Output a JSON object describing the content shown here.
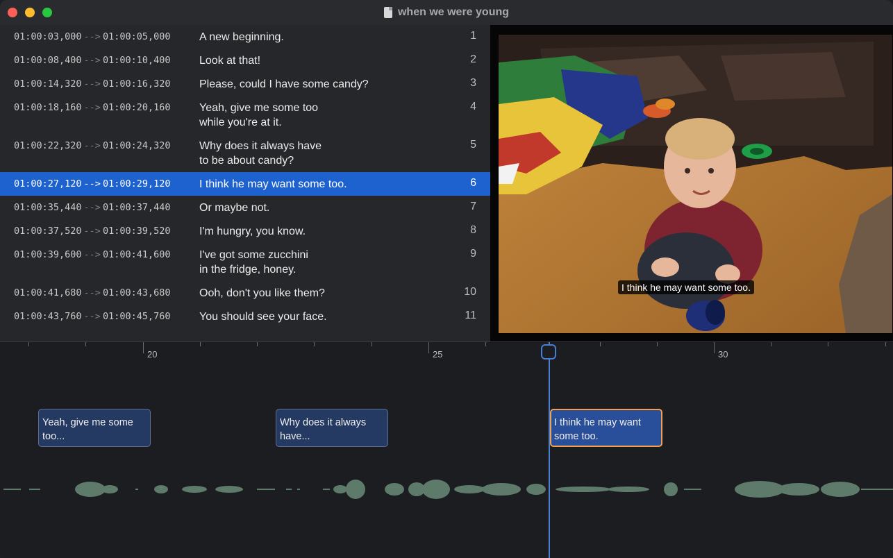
{
  "window": {
    "title": "when we were young"
  },
  "subtitles": [
    {
      "start": "01:00:03,000",
      "end": "01:00:05,000",
      "text": "A new beginning.",
      "num": "1"
    },
    {
      "start": "01:00:08,400",
      "end": "01:00:10,400",
      "text": "Look at that!",
      "num": "2"
    },
    {
      "start": "01:00:14,320",
      "end": "01:00:16,320",
      "text": "Please, could I have some candy?",
      "num": "3"
    },
    {
      "start": "01:00:18,160",
      "end": "01:00:20,160",
      "text": "Yeah, give me some too\nwhile you're at it.",
      "num": "4"
    },
    {
      "start": "01:00:22,320",
      "end": "01:00:24,320",
      "text": "Why does it always have\nto be about candy?",
      "num": "5"
    },
    {
      "start": "01:00:27,120",
      "end": "01:00:29,120",
      "text": "I think he may want some too.",
      "num": "6",
      "selected": true
    },
    {
      "start": "01:00:35,440",
      "end": "01:00:37,440",
      "text": "Or maybe not.",
      "num": "7"
    },
    {
      "start": "01:00:37,520",
      "end": "01:00:39,520",
      "text": "I'm hungry, you know.",
      "num": "8"
    },
    {
      "start": "01:00:39,600",
      "end": "01:00:41,600",
      "text": "I've got some zucchini\nin the fridge, honey.",
      "num": "9"
    },
    {
      "start": "01:00:41,680",
      "end": "01:00:43,680",
      "text": "Ooh, don't you like them?",
      "num": "10"
    },
    {
      "start": "01:00:43,760",
      "end": "01:00:45,760",
      "text": "You should see your face.",
      "num": "11"
    }
  ],
  "arrow": "-->",
  "video": {
    "caption": "I think he may want some too."
  },
  "timeline": {
    "labels": [
      "20",
      "25",
      "30"
    ],
    "blocks": [
      {
        "text": "Yeah, give me some too..."
      },
      {
        "text": "Why does it always have..."
      },
      {
        "text": "I think he may want some too."
      }
    ]
  },
  "colors": {
    "selection": "#1e62d0",
    "playhead": "#4a7fd6",
    "active_block_border": "#f0a050",
    "waveform": "#5d7a6a"
  }
}
